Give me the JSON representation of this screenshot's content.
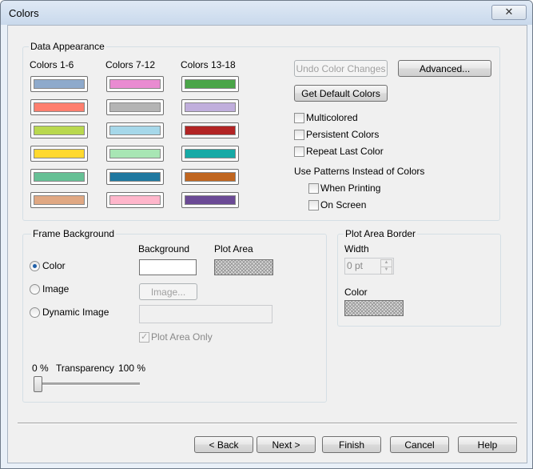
{
  "window": {
    "title": "Colors",
    "close_glyph": "✕"
  },
  "data_appearance": {
    "label": "Data Appearance",
    "columns": [
      {
        "label": "Colors 1-6",
        "swatches": [
          "#8eaacc",
          "#ff7f6e",
          "#b9d84f",
          "#ffd92f",
          "#66c095",
          "#e0a883"
        ]
      },
      {
        "label": "Colors 7-12",
        "swatches": [
          "#e98bd1",
          "#b4b4b4",
          "#a6d8ea",
          "#a8e6b4",
          "#1f78a0",
          "#ffb6cb"
        ]
      },
      {
        "label": "Colors 13-18",
        "swatches": [
          "#4aa548",
          "#c0aedc",
          "#b22424",
          "#17aaa6",
          "#c06620",
          "#6b4a95"
        ]
      }
    ],
    "undo_button": "Undo Color Changes",
    "advanced_button": "Advanced...",
    "default_button": "Get Default Colors",
    "multicolored": "Multicolored",
    "persistent": "Persistent Colors",
    "repeat_last": "Repeat Last Color",
    "patterns_label": "Use Patterns Instead of Colors",
    "when_printing": "When Printing",
    "on_screen": "On Screen"
  },
  "frame_background": {
    "label": "Frame Background",
    "background_label": "Background",
    "plot_area_label": "Plot Area",
    "color_option": "Color",
    "image_option": "Image",
    "dynamic_image_option": "Dynamic Image",
    "image_button": "Image...",
    "plot_area_only": "Plot Area Only",
    "transparency_min": "0 %",
    "transparency_label": "Transparency",
    "transparency_max": "100 %",
    "transparency_value": 0
  },
  "plot_area_border": {
    "label": "Plot Area Border",
    "width_label": "Width",
    "width_value": "0 pt",
    "color_label": "Color"
  },
  "footer": {
    "back": "< Back",
    "next": "Next >",
    "finish": "Finish",
    "cancel": "Cancel",
    "help": "Help"
  }
}
